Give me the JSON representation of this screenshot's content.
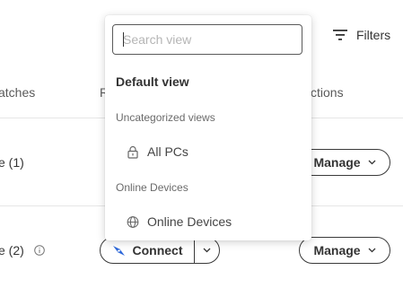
{
  "toolbar": {
    "filters_label": "Filters",
    "filter_icon": "filter-lines-icon"
  },
  "table": {
    "headers": {
      "patches": "atches",
      "r": "R",
      "actions": "ctions"
    },
    "rows": [
      {
        "name": "e (1)",
        "manage_label": "Manage"
      },
      {
        "name": "e (2)",
        "manage_label": "Manage",
        "connect_label": "Connect"
      }
    ]
  },
  "view_dropdown": {
    "search_placeholder": "Search view",
    "search_value": "",
    "default_view": "Default view",
    "groups": [
      {
        "label": "Uncategorized views",
        "items": [
          {
            "label": "All PCs",
            "icon": "lock-icon"
          }
        ]
      },
      {
        "label": "Online Devices",
        "items": [
          {
            "label": "Online Devices",
            "icon": "globe-icon"
          }
        ]
      }
    ]
  },
  "colors": {
    "accent": "#2b66d9",
    "border": "#3a3a3a",
    "divider": "#e6e6e6"
  }
}
